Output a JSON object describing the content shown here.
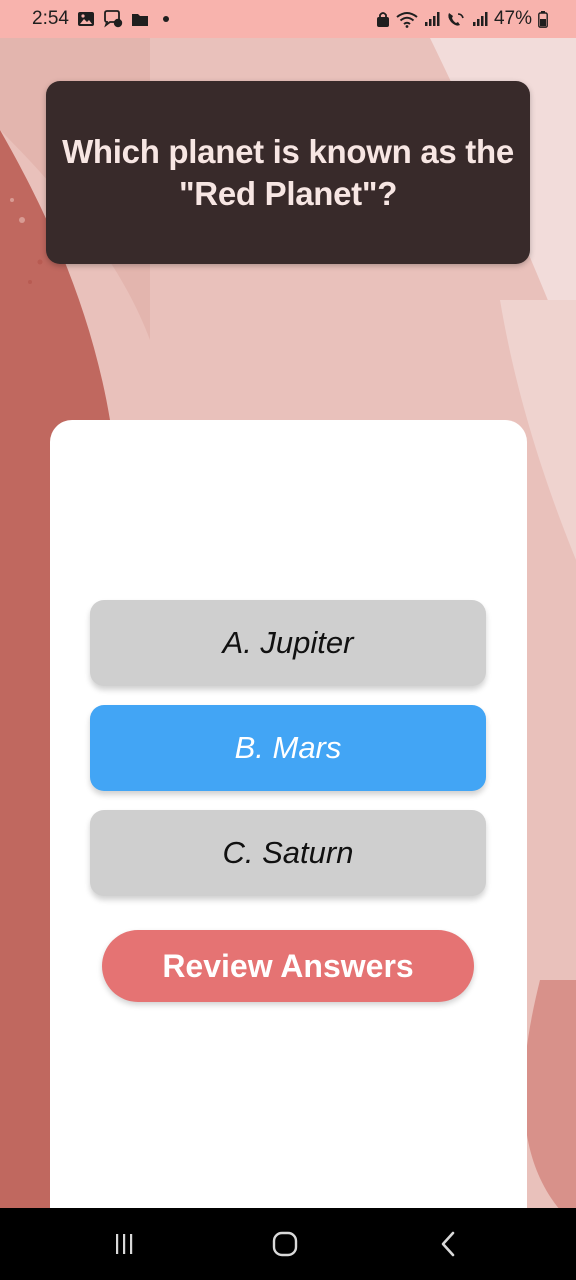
{
  "status_bar": {
    "time": "2:54",
    "battery_percent": "47%",
    "icons": [
      "image-icon",
      "messenger-icon",
      "folder-icon",
      "notification-dot-icon",
      "lock-icon",
      "wifi-icon",
      "signal-icon",
      "wifi-call-icon",
      "signal-icon-2",
      "battery-icon"
    ]
  },
  "question": {
    "text": "Which planet is known as the \"Red Planet\"?"
  },
  "options": [
    {
      "label": "A. Jupiter",
      "state": "default"
    },
    {
      "label": "B. Mars",
      "state": "selected"
    },
    {
      "label": "C. Saturn",
      "state": "default"
    }
  ],
  "review_button": {
    "label": "Review Answers"
  },
  "navigation": {
    "icons": [
      "recent-apps-icon",
      "home-icon",
      "back-icon"
    ]
  },
  "colors": {
    "status_bar": "#f8b3ad",
    "background": "#e9c1bb",
    "question_card": "#382a2a",
    "option_default": "#cfcfcf",
    "option_selected": "#42a5f5",
    "review_button": "#e57373",
    "nav_bar": "#000000"
  }
}
